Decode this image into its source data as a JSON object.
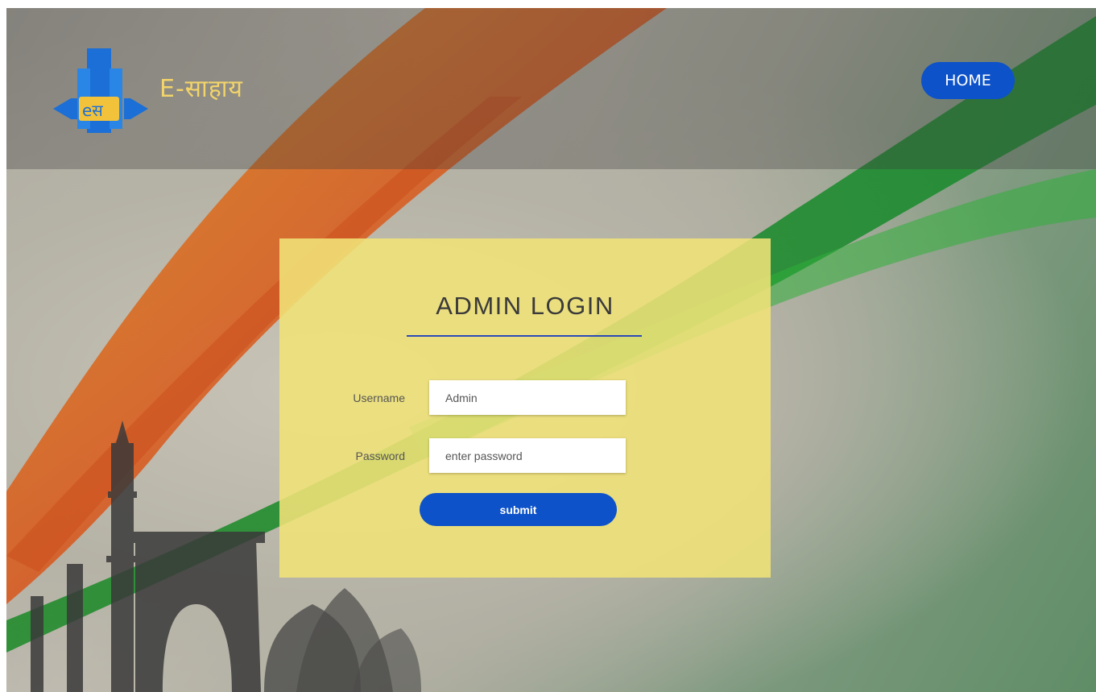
{
  "header": {
    "brand_name": "E-साहाय",
    "home_label": "HOME"
  },
  "login": {
    "title": "ADMIN LOGIN",
    "username_label": "Username",
    "username_value": "Admin",
    "password_label": "Password",
    "password_placeholder": "enter password",
    "submit_label": "submit"
  },
  "colors": {
    "accent_blue": "#0d52c9",
    "card_yellow": "#f0e278",
    "brand_gold": "#f2d46a"
  },
  "icons": {
    "logo": "e-sahay-logo-icon"
  }
}
